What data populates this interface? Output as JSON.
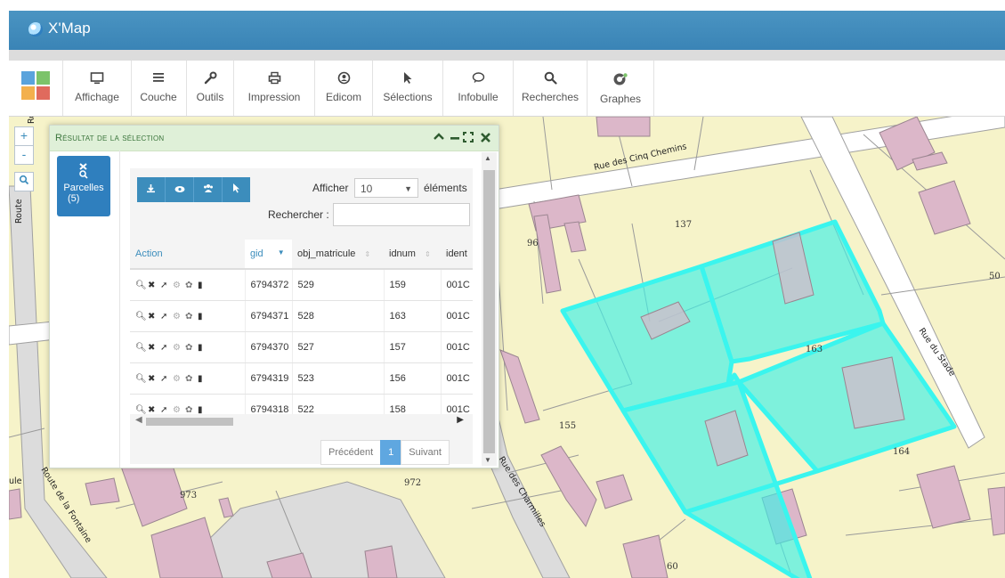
{
  "app": {
    "title": "X'Map"
  },
  "toolbar": {
    "items": [
      {
        "label": "Affichage",
        "icon": "monitor-icon"
      },
      {
        "label": "Couche",
        "icon": "layers-list-icon"
      },
      {
        "label": "Outils",
        "icon": "wrench-icon"
      },
      {
        "label": "Impression",
        "icon": "printer-icon"
      },
      {
        "label": "Edicom",
        "icon": "edicom-icon"
      },
      {
        "label": "Sélections",
        "icon": "pointer-icon"
      },
      {
        "label": "Infobulle",
        "icon": "speech-bubble-icon"
      },
      {
        "label": "Recherches",
        "icon": "search-icon"
      },
      {
        "label": "Graphes",
        "icon": "graph-icon"
      }
    ]
  },
  "colors": {
    "appbar": "#3c8dbc",
    "map_background": "#f6f3c9",
    "building": "#dcb7c9",
    "selection": "#3ef0e6",
    "panel_header": "#dff0d8",
    "button": "#3c8dbc"
  },
  "map": {
    "zoom_in": "+",
    "zoom_out": "-",
    "streets": [
      "Rue des Cinq Chemins",
      "Rue du Stade",
      "Rue des Charmilles",
      "Route de la Fontaine",
      "Route",
      "Route",
      "ule"
    ],
    "parcel_labels": [
      "137",
      "96",
      "50",
      "163",
      "155",
      "164",
      "973",
      "972",
      "60"
    ]
  },
  "panel": {
    "title": "Résultat de la sélection",
    "controls": [
      "^",
      "–",
      "⛶",
      "✖"
    ],
    "tab": {
      "label": "Parcelles",
      "count": "(5)"
    },
    "afficher": "Afficher",
    "page_size": "10",
    "elements": "éléments",
    "rechercher": "Rechercher :",
    "columns": [
      "Action",
      "gid",
      "obj_matricule",
      "idnum",
      "ident"
    ],
    "rows": [
      {
        "gid": "6794372",
        "obj_matricule": "529",
        "idnum": "159",
        "ident": "001C"
      },
      {
        "gid": "6794371",
        "obj_matricule": "528",
        "idnum": "163",
        "ident": "001C"
      },
      {
        "gid": "6794370",
        "obj_matricule": "527",
        "idnum": "157",
        "ident": "001C"
      },
      {
        "gid": "6794319",
        "obj_matricule": "523",
        "idnum": "156",
        "ident": "001C"
      },
      {
        "gid": "6794318",
        "obj_matricule": "522",
        "idnum": "158",
        "ident": "001C"
      }
    ],
    "pager": {
      "prev": "Précédent",
      "page": "1",
      "next": "Suivant"
    }
  }
}
